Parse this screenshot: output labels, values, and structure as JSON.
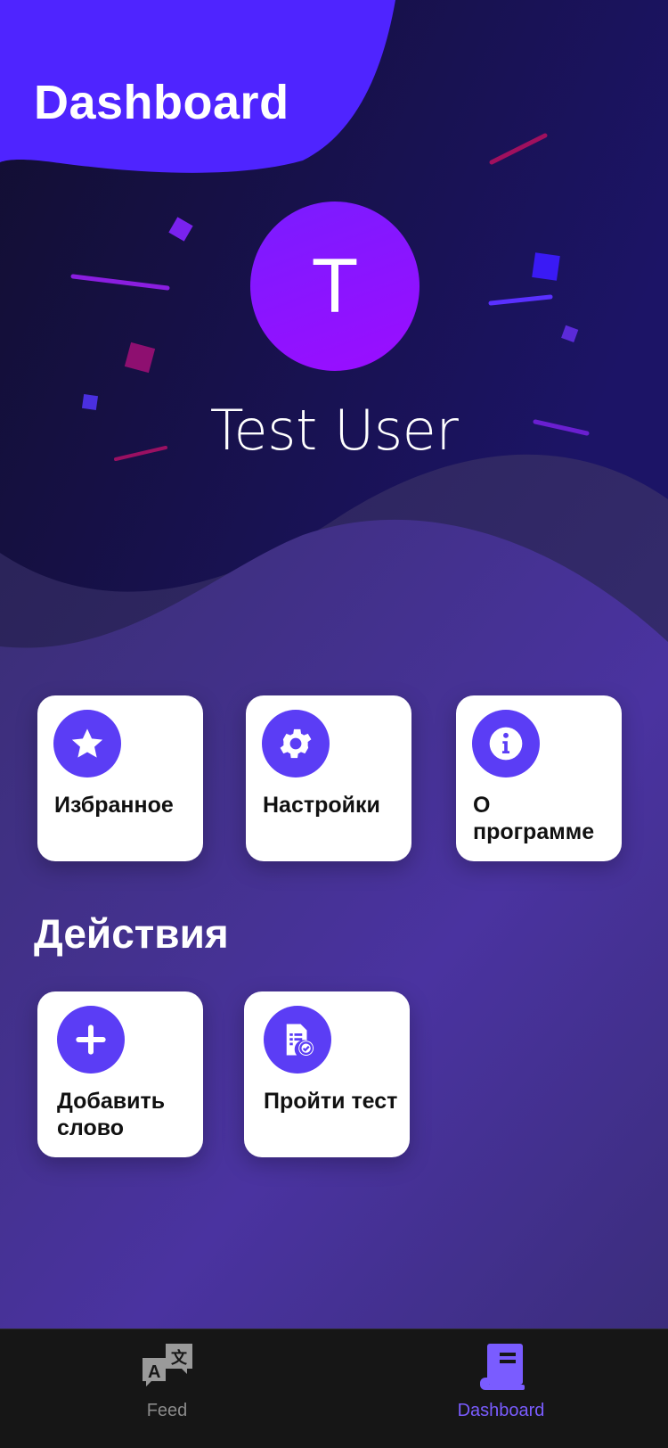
{
  "header": {
    "title": "Dashboard"
  },
  "profile": {
    "avatar_initial": "T",
    "name": "Test User"
  },
  "quick_actions": [
    {
      "label": "Избранное",
      "icon": "star-icon"
    },
    {
      "label": "Настройки",
      "icon": "gear-icon"
    },
    {
      "label": "О программе",
      "icon": "info-icon"
    }
  ],
  "actions_section": {
    "title": "Действия",
    "items": [
      {
        "label": "Добавить слово",
        "icon": "plus-icon"
      },
      {
        "label": "Пройти тест",
        "icon": "test-document-icon"
      }
    ]
  },
  "tabbar": {
    "tabs": [
      {
        "label": "Feed",
        "icon": "translate-icon",
        "active": false
      },
      {
        "label": "Dashboard",
        "icon": "book-icon",
        "active": true
      }
    ]
  },
  "colors": {
    "accent": "#5b3df5",
    "header_blob": "#4f24ff",
    "avatar": "#8a12ff",
    "tab_active": "#7a5cff",
    "tab_inactive": "#8a8a8a"
  }
}
